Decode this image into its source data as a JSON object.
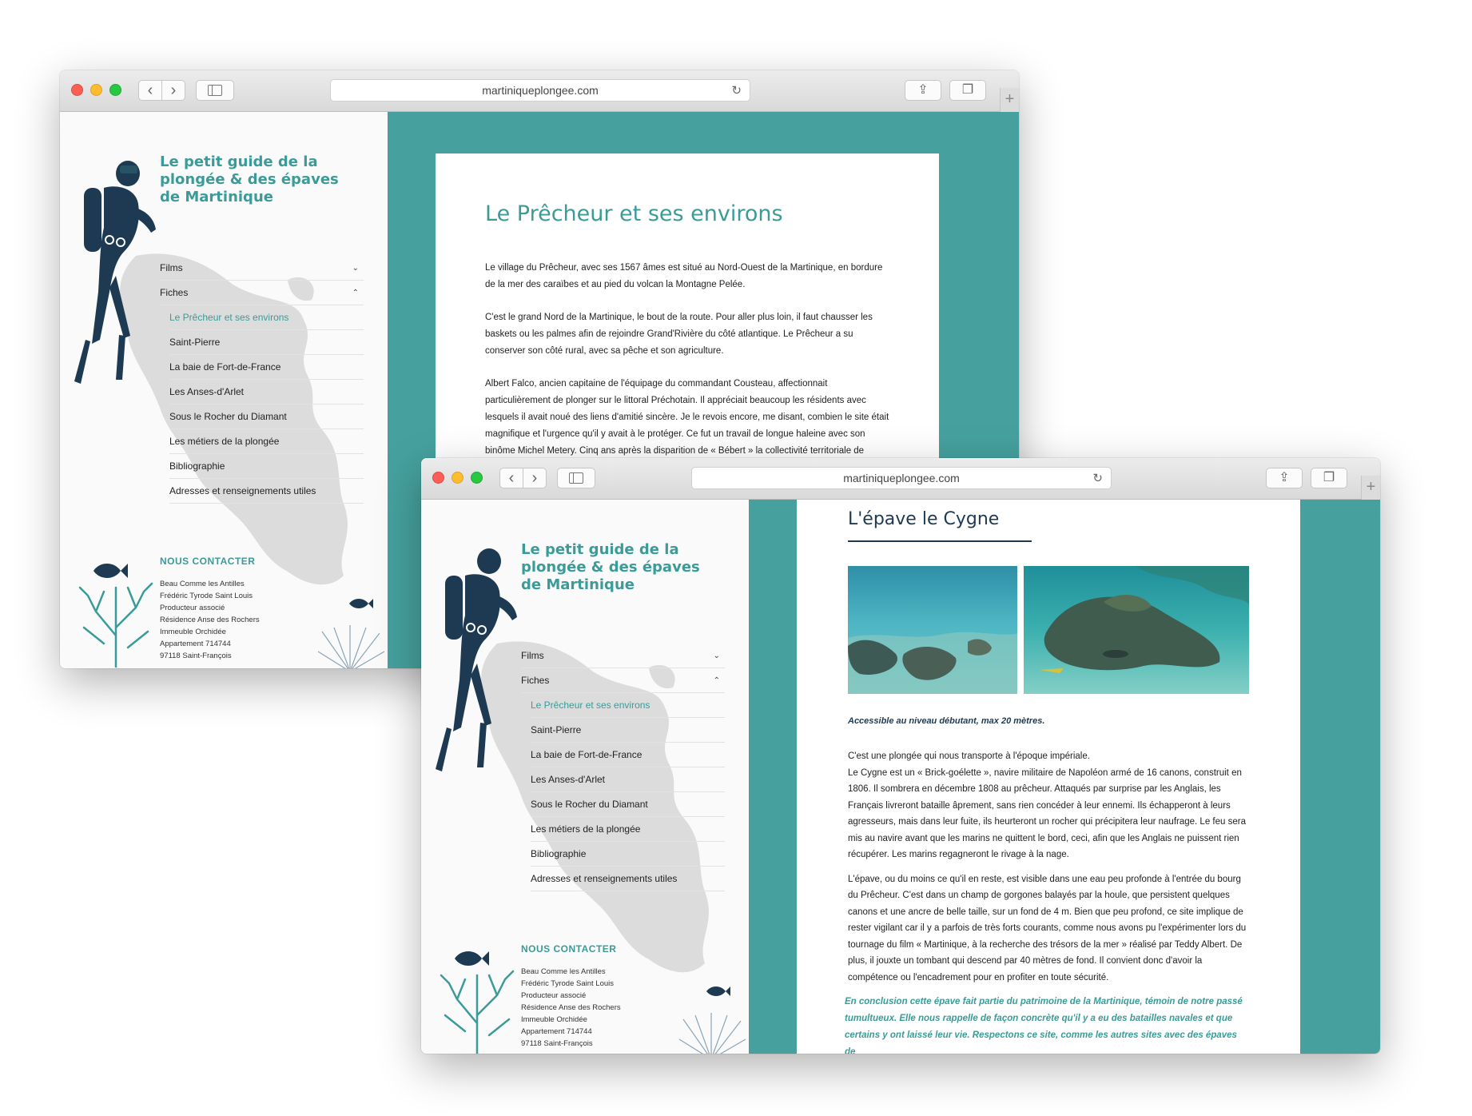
{
  "browser": {
    "url": "martiniqueplongee.com"
  },
  "site": {
    "title": "Le petit guide de la plongée & des épaves de Martinique",
    "menu": [
      {
        "label": "Films",
        "chevron": "⌄"
      },
      {
        "label": "Fiches",
        "chevron": "⌃"
      }
    ],
    "submenu": [
      "Le Prêcheur et ses environs",
      "Saint-Pierre",
      "La baie de Fort-de-France",
      "Les Anses-d'Arlet",
      "Sous le Rocher du Diamant",
      "Les métiers de la plongée",
      "Bibliographie",
      "Adresses et renseignements utiles"
    ],
    "contact_heading": "NOUS CONTACTER",
    "contact_lines": [
      "Beau Comme les Antilles",
      "Frédéric Tyrode Saint Louis",
      "Producteur associé",
      "Résidence Anse des Rochers",
      "Immeuble Orchidée",
      "Appartement 714744",
      "97118 Saint-François"
    ]
  },
  "window1": {
    "article_title": "Le Prêcheur et ses environs",
    "paragraphs": [
      "Le village du Prêcheur, avec ses 1567 âmes est situé au Nord-Ouest de la  Martinique, en bordure de la mer des caraïbes et au pied du volcan la Montagne Pelée.",
      "C'est le grand Nord de la Martinique, le bout de la route. Pour aller plus loin, il faut chausser les baskets ou les palmes afin de rejoindre Grand'Rivière du côté atlantique. Le Prêcheur a su conserver son côté rural, avec sa pêche et son agriculture.",
      "Albert Falco, ancien capitaine de l'équipage du commandant Cousteau, affectionnait particulièrement de plonger sur le littoral Préchotain. Il appréciait beaucoup les résidents avec lesquels il avait noué des liens d'amitié sincère. Je le revois encore, me disant, combien le site était magnifique et l'urgence qu'il y avait à le protéger. Ce fut un travail de longue haleine avec son binôme Michel Metery. Cinq ans après la disparition de « Bébert » la collectivité territoriale de Marti-"
    ]
  },
  "window2": {
    "article_title": "L'épave le Cygne",
    "caption": "Accessible au niveau débutant, max 20 mètres.",
    "paragraphs": [
      "C'est une plongée qui nous transporte à l'époque impériale.\nLe Cygne est un « Brick-goélette », navire militaire de Napoléon armé de 16 canons, construit en 1806. Il sombrera en décembre 1808 au prêcheur. Attaqués par surprise par les Anglais, les Français livreront bataille âprement, sans rien concéder à leur ennemi. Ils échapperont à leurs agresseurs, mais dans leur fuite, ils heurteront un rocher qui précipitera leur naufrage. Le feu sera mis au navire avant que les marins ne quittent le bord, ceci, afin que les Anglais ne puissent rien récupérer. Les marins regagneront le rivage à la nage.",
      "L'épave, ou du moins ce qu'il en reste, est visible dans une eau peu profonde à l'entrée du bourg du Prêcheur. C'est dans un champ de gorgones balayés par la houle, que persistent quelques canons et une ancre de belle taille, sur un fond de 4 m. Bien que peu profond, ce site implique de rester vigilant car il y a parfois de très forts courants, comme nous avons pu l'expérimenter lors du tournage du film « Martinique, à la recherche des trésors de la mer » réalisé par Teddy Albert. De plus, il jouxte un tombant qui descend par 40 mètres de fond. Il convient donc d'avoir la compétence ou l'encadrement pour en profiter en toute sécurité."
    ],
    "conclusion": "En conclusion cette épave fait partie du patrimoine de la Martinique, témoin de notre passé tumultueux. Elle nous rappelle de façon concrète qu'il y a eu des batailles navales et que certains y ont laissé leur vie. Respectons ce site, comme les autres sites avec des épaves de"
  },
  "icons": {
    "back": "‹",
    "forward": "›",
    "reload": "↻",
    "share": "⇪",
    "tabs": "❐",
    "plus": "+"
  },
  "colors": {
    "teal": "#46a19e",
    "brand_text": "#3a9b98",
    "navy": "#1e3a52",
    "island_gray": "#dcdcdc"
  }
}
